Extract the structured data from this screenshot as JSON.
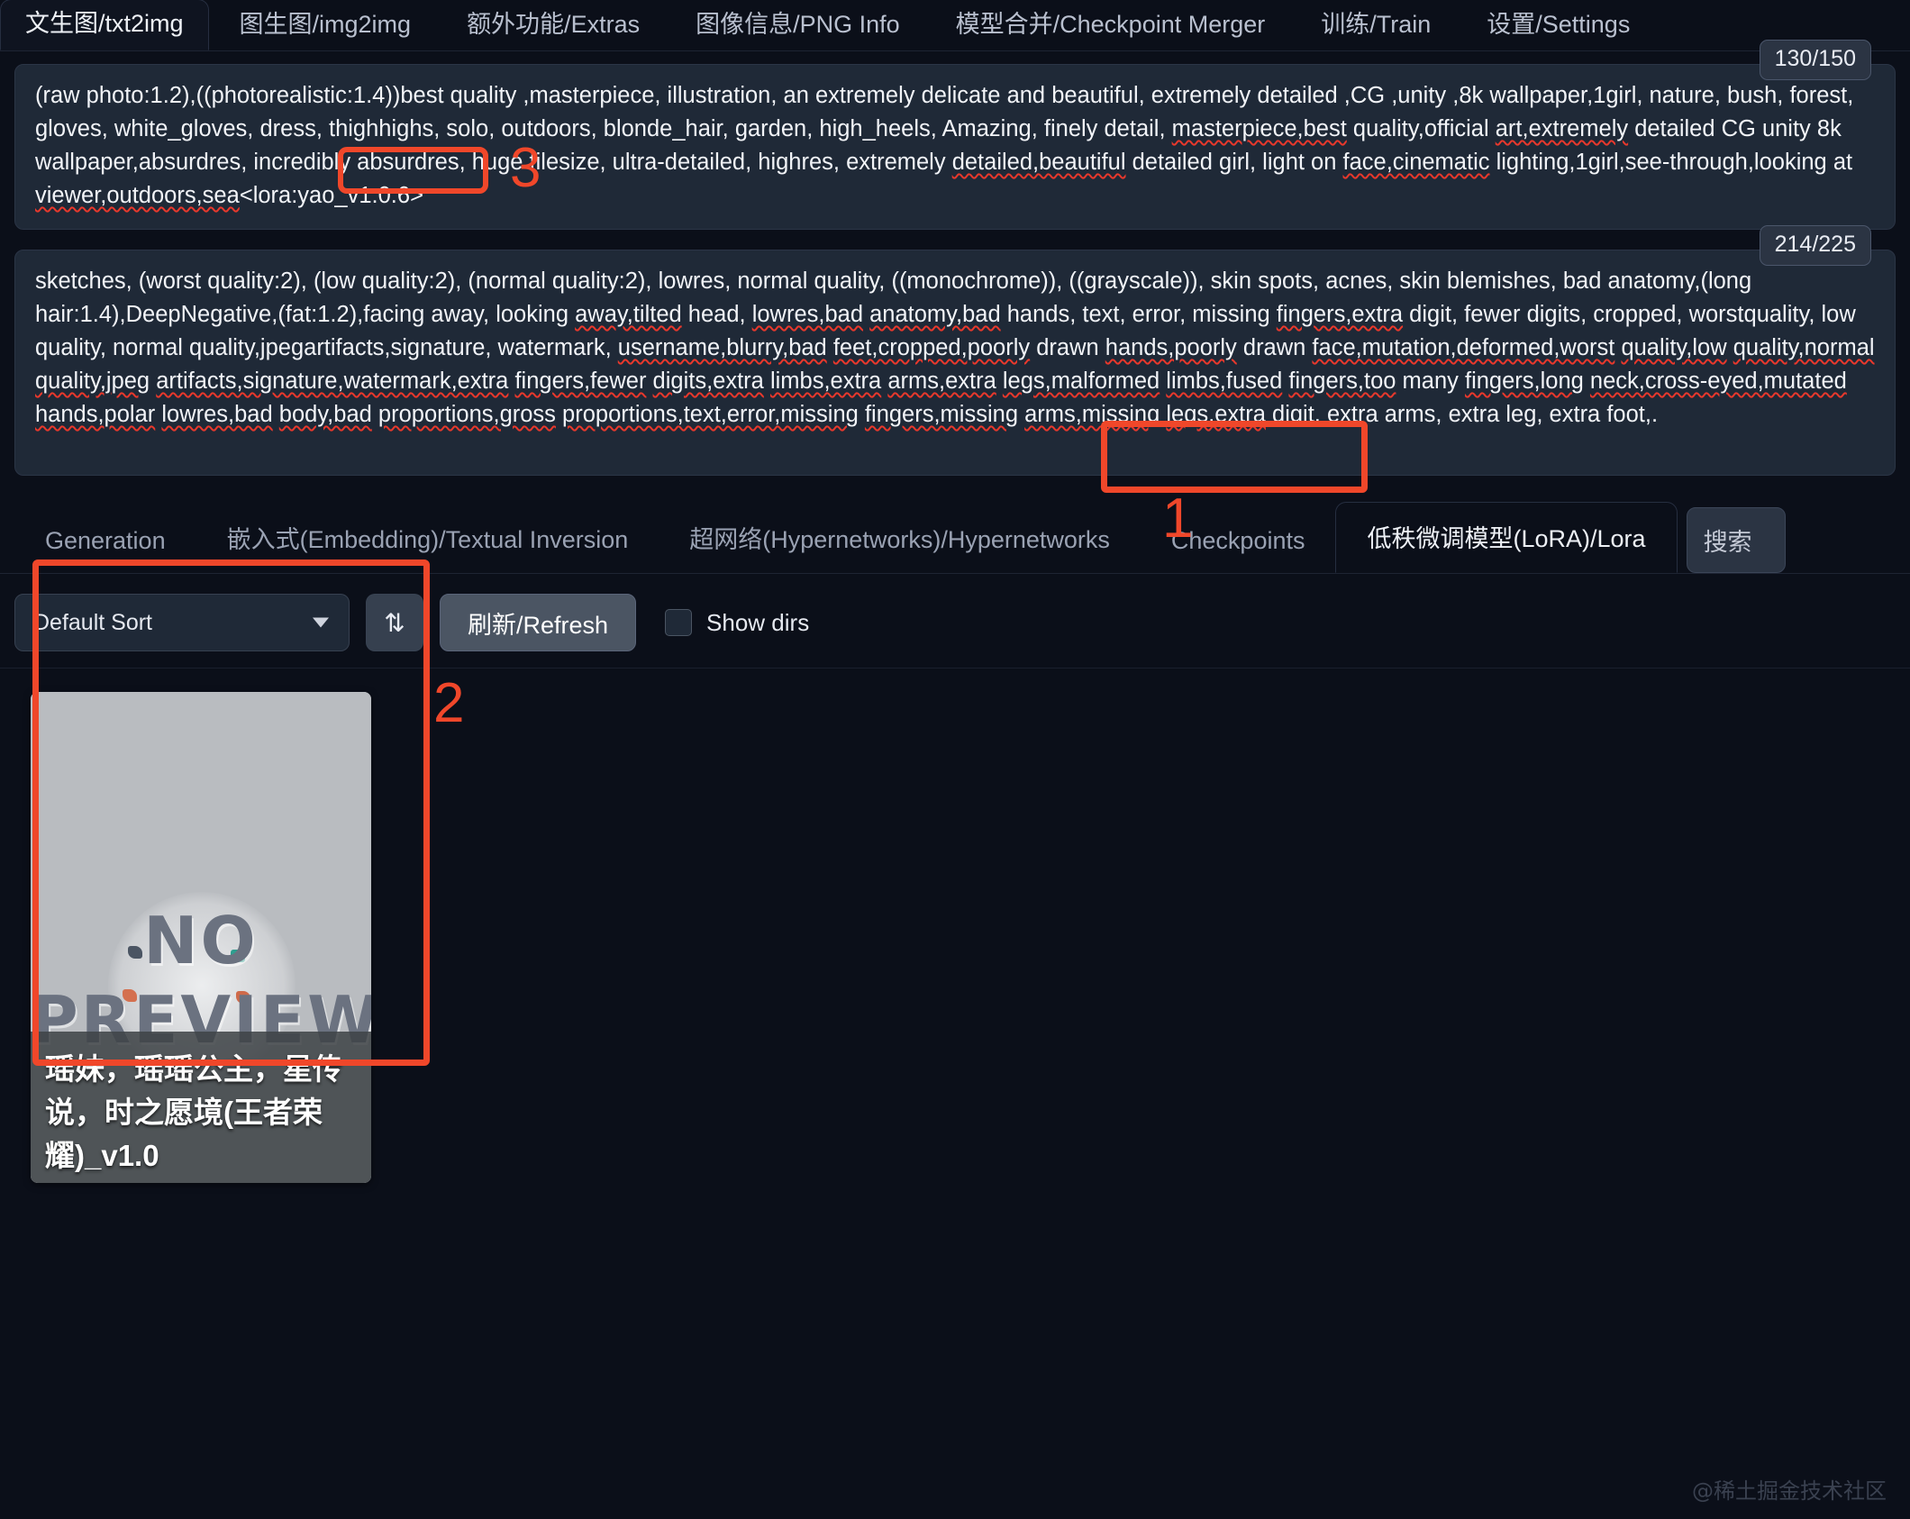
{
  "top_tabs": [
    {
      "label": "文生图/txt2img",
      "active": true
    },
    {
      "label": "图生图/img2img",
      "active": false
    },
    {
      "label": "额外功能/Extras",
      "active": false
    },
    {
      "label": "图像信息/PNG Info",
      "active": false
    },
    {
      "label": "模型合并/Checkpoint Merger",
      "active": false
    },
    {
      "label": "训练/Train",
      "active": false
    },
    {
      "label": "设置/Settings",
      "active": false
    }
  ],
  "prompt": {
    "text": "(raw photo:1.2),((photorealistic:1.4))best quality ,masterpiece, illustration, an extremely delicate and beautiful, extremely detailed ,CG ,unity ,8k wallpaper,1girl, nature, bush, forest, gloves, white_gloves, dress, thighhighs, solo, outdoors, blonde_hair, garden, high_heels, Amazing, finely detail, masterpiece,best quality,official art,extremely detailed CG unity 8k wallpaper,absurdres, incredibly absurdres, huge filesize, ultra-detailed, highres, extremely detailed,beautiful detailed girl, light on face,cinematic lighting,1girl,see-through,looking at viewer,outdoors,sea",
    "lora_tag": "<lora:yao_v1:0.6>",
    "counter": "130/150"
  },
  "negative_prompt": {
    "text": "sketches, (worst quality:2), (low quality:2), (normal quality:2), lowres, normal quality, ((monochrome)), ((grayscale)), skin spots, acnes, skin blemishes, bad anatomy,(long hair:1.4),DeepNegative,(fat:1.2),facing away, looking away,tilted head, lowres,bad anatomy,bad hands, text, error, missing fingers,extra digit, fewer digits, cropped, worstquality, low quality, normal quality,jpegartifacts,signature, watermark, username,blurry,bad feet,cropped,poorly drawn hands,poorly drawn face,mutation,deformed,worst quality,low quality,normal quality,jpeg artifacts,signature,watermark,extra fingers,fewer digits,extra limbs,extra arms,extra legs,malformed limbs,fused fingers,too many fingers,long neck,cross-eyed,mutated hands,polar lowres,bad body,bad proportions,gross proportions,text,error,missing fingers,missing arms,missing legs,extra digit, extra arms, extra leg, extra foot,.",
    "counter": "214/225"
  },
  "extra_networks": {
    "tabs": [
      {
        "label": "Generation",
        "active": false
      },
      {
        "label": "嵌入式(Embedding)/Textual Inversion",
        "active": false
      },
      {
        "label": "超网络(Hypernetworks)/Hypernetworks",
        "active": false
      },
      {
        "label": "Checkpoints",
        "active": false
      },
      {
        "label": "低秩微调模型(LoRA)/Lora",
        "active": true
      }
    ],
    "search_button": "搜索"
  },
  "toolbar": {
    "sort_value": "Default Sort",
    "sort_direction_icon": "sort-arrows-icon",
    "refresh_label": "刷新/Refresh",
    "show_dirs_label": "Show dirs",
    "show_dirs_checked": false
  },
  "cards": [
    {
      "placeholder_line1": "NO",
      "placeholder_line2": "PREVIEW",
      "caption": "瑶妹，瑶瑶公主，星传说，时之愿境(王者荣耀)_v1.0"
    }
  ],
  "annotations": [
    {
      "id": "1",
      "target": "lora-tab"
    },
    {
      "id": "2",
      "target": "lora-card"
    },
    {
      "id": "3",
      "target": "lora-prompt-tag"
    }
  ],
  "watermark": "@稀土掘金技术社区",
  "colors": {
    "accent_red": "#f0472a",
    "spellcheck_red": "#e8382c",
    "page_bg": "#0b0f19",
    "panel_bg": "#1f2937"
  }
}
